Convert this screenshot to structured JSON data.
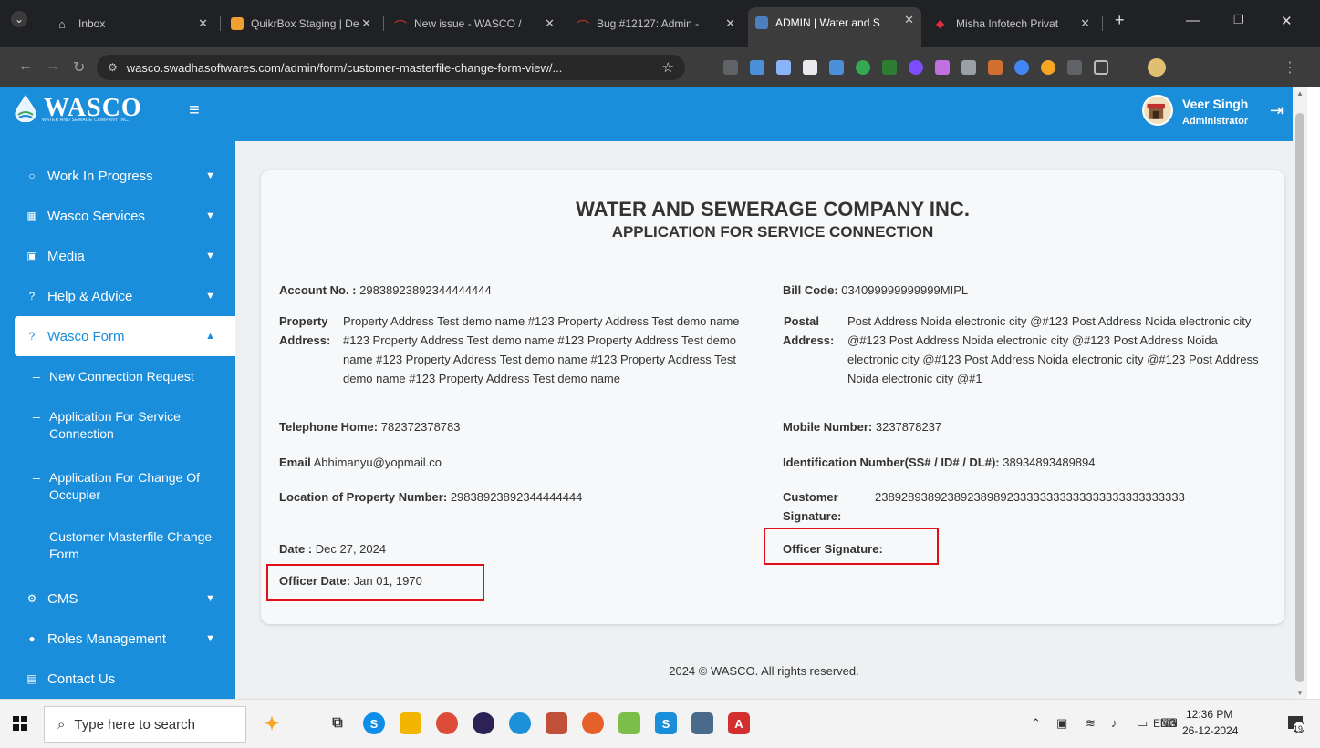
{
  "browser": {
    "tabs": [
      {
        "title": "Inbox",
        "color": "#5f6368"
      },
      {
        "title": "QuikrBox Staging | De",
        "color": "#f0a030"
      },
      {
        "title": "New issue - WASCO /",
        "color": "#d9342b"
      },
      {
        "title": "Bug #12127: Admin -",
        "color": "#d9342b"
      },
      {
        "title": "ADMIN | Water and S",
        "color": "#4a7fc0"
      },
      {
        "title": "Misha Infotech Privat",
        "color": "#e03040"
      }
    ],
    "new_tab": "+",
    "url": "wasco.swadhasoftwares.com/admin/form/customer-masterfile-change-form-view/..."
  },
  "header": {
    "logo": "WASCO",
    "logo_sub": "WATER AND SEWAGE COMPANY INC.",
    "user_name": "Veer Singh",
    "user_role": "Administrator"
  },
  "sidebar": {
    "items": [
      {
        "label": "Work In Progress",
        "icon": "circle-icon"
      },
      {
        "label": "Wasco Services",
        "icon": "grid-icon"
      },
      {
        "label": "Media",
        "icon": "image-icon"
      },
      {
        "label": "Help & Advice",
        "icon": "question-icon"
      },
      {
        "label": "Wasco Form",
        "icon": "question-icon"
      },
      {
        "label": "CMS",
        "icon": "cogs-icon"
      },
      {
        "label": "Roles Management",
        "icon": "user-icon"
      },
      {
        "label": "Contact Us",
        "icon": "contact-card-icon"
      }
    ],
    "subitems": [
      {
        "label": "New Connection Request"
      },
      {
        "label": "Application For Service Connection"
      },
      {
        "label": "Application For Change Of Occupier"
      },
      {
        "label": "Customer Masterfile Change Form"
      }
    ]
  },
  "form": {
    "company": "WATER AND SEWERAGE COMPANY INC.",
    "subtitle": "APPLICATION FOR SERVICE CONNECTION",
    "account_label": "Account No. :",
    "account_value": "29838923892344444444",
    "bill_label": "Bill Code:",
    "bill_value": "034099999999999MIPL",
    "property_label_1": "Property",
    "property_label_2": "Address:",
    "property_value": "Property Address Test demo name #123 Property Address Test demo name #123 Property Address Test demo name #123 Property Address Test demo name #123 Property Address Test demo name #123 Property Address Test demo name #123 Property Address Test demo name",
    "postal_label_1": "Postal",
    "postal_label_2": "Address:",
    "postal_value": "Post Address Noida electronic city @#123 Post Address Noida electronic city @#123 Post Address Noida electronic city @#123 Post Address Noida electronic city @#123 Post Address Noida electronic city @#123 Post Address Noida electronic city @#1",
    "telephone_label": "Telephone Home:",
    "telephone_value": "782372378783",
    "mobile_label": "Mobile Number:",
    "mobile_value": "3237878237",
    "email_label": "Email",
    "email_value": "Abhimanyu@yopmail.co",
    "id_label": "Identification Number(SS# / ID# / DL#):",
    "id_value": "38934893489894",
    "location_label": "Location of Property Number:",
    "location_value": "29838923892344444444",
    "customer_sig_label_1": "Customer",
    "customer_sig_label_2": "Signature:",
    "customer_sig_value": "23892893892389238989233333333333333333333333333",
    "date_label": "Date :",
    "date_value": "Dec 27, 2024",
    "officer_sig_label": "Officer Signature:",
    "officer_date_label": "Officer Date:",
    "officer_date_value": "Jan 01, 1970"
  },
  "footer": "2024 © WASCO. All rights reserved.",
  "taskbar": {
    "search_placeholder": "Type here to search",
    "time": "12:36 PM",
    "date": "26-12-2024",
    "lang": "ENG",
    "notification_count": "19"
  },
  "colors": {
    "brand": "#1a8ddb",
    "highlight": "#e0101a"
  }
}
